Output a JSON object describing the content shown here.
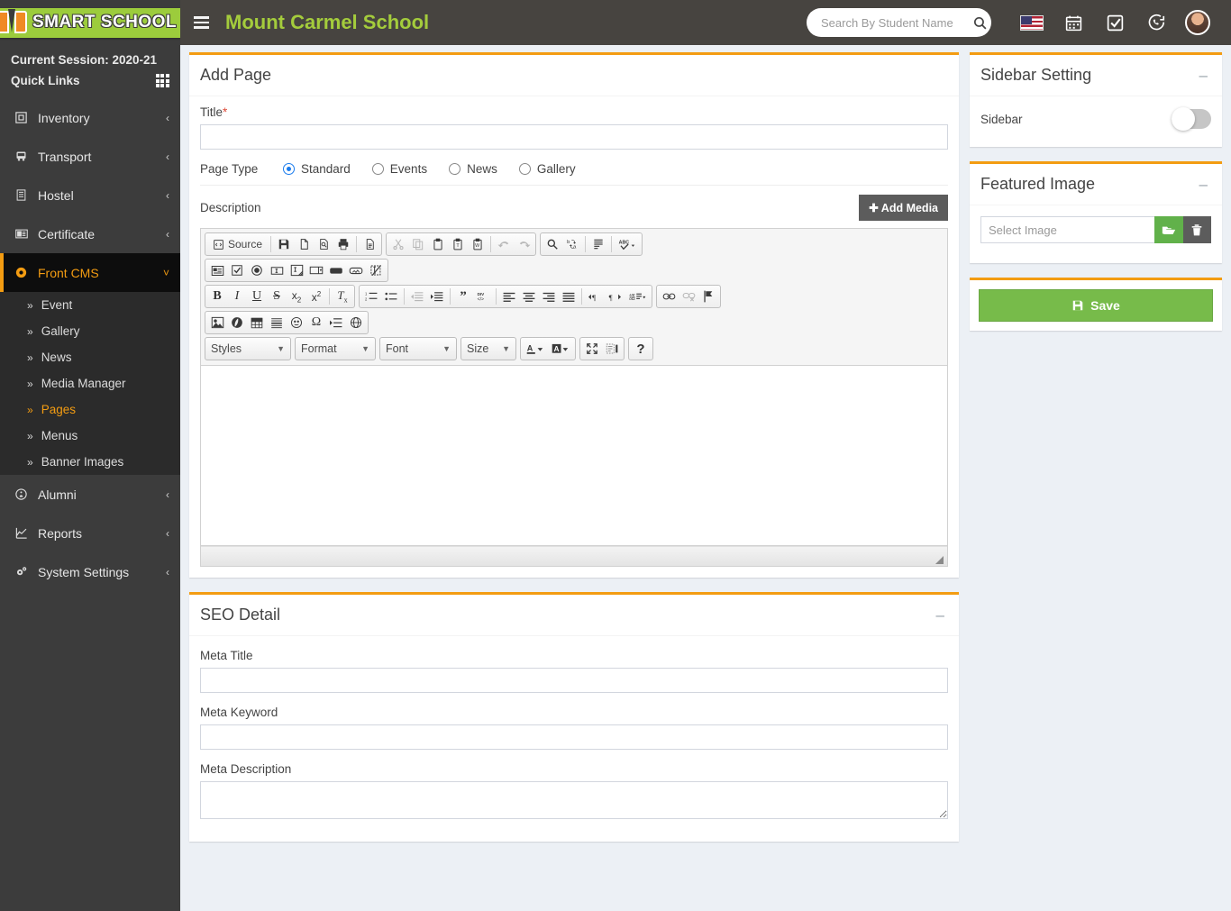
{
  "header": {
    "logo_text": "SMART SCHOOL",
    "school_name": "Mount Carmel School",
    "search_placeholder": "Search By Student Name",
    "icons": [
      "flag-icon",
      "calendar-icon",
      "checkbox-icon",
      "whatsapp-icon",
      "avatar"
    ]
  },
  "sidebar": {
    "session_label": "Current Session: 2020-21",
    "quick_links_label": "Quick Links",
    "items": [
      {
        "label": "Inventory",
        "icon": "inventory-icon",
        "arrow": "‹"
      },
      {
        "label": "Transport",
        "icon": "bus-icon",
        "arrow": "‹"
      },
      {
        "label": "Hostel",
        "icon": "building-icon",
        "arrow": "‹"
      },
      {
        "label": "Certificate",
        "icon": "certificate-icon",
        "arrow": "‹"
      },
      {
        "label": "Front CMS",
        "icon": "cms-icon",
        "arrow": "˅",
        "active": true
      },
      {
        "label": "Alumni",
        "icon": "alumni-icon",
        "arrow": "‹"
      },
      {
        "label": "Reports",
        "icon": "reports-icon",
        "arrow": "‹"
      },
      {
        "label": "System Settings",
        "icon": "gears-icon",
        "arrow": "‹"
      }
    ],
    "submenu": [
      {
        "label": "Event"
      },
      {
        "label": "Gallery"
      },
      {
        "label": "News"
      },
      {
        "label": "Media Manager"
      },
      {
        "label": "Pages",
        "current": true
      },
      {
        "label": "Menus"
      },
      {
        "label": "Banner Images"
      }
    ]
  },
  "add_page": {
    "title": "Add Page",
    "title_label": "Title",
    "title_required": "*",
    "title_value": "",
    "page_type_label": "Page Type",
    "page_types": [
      {
        "label": "Standard",
        "selected": true
      },
      {
        "label": "Events",
        "selected": false
      },
      {
        "label": "News",
        "selected": false
      },
      {
        "label": "Gallery",
        "selected": false
      }
    ],
    "description_label": "Description",
    "add_media_label": "Add Media",
    "add_media_icon": "plus-icon"
  },
  "editor": {
    "source_label": "Source",
    "styles_label": "Styles",
    "format_label": "Format",
    "font_label": "Font",
    "size_label": "Size",
    "content": "",
    "row1_group1": [
      "source-button",
      "save-icon",
      "new-page-icon",
      "preview-icon",
      "print-icon",
      "templates-icon"
    ],
    "row1_group2": [
      "cut-icon",
      "copy-icon",
      "paste-icon",
      "paste-text-icon",
      "paste-word-icon",
      "undo-icon",
      "redo-icon"
    ],
    "row1_group3": [
      "find-icon",
      "replace-icon",
      "select-all-icon",
      "spellcheck-icon"
    ],
    "row2_group1": [
      "form-icon",
      "checkbox-icon",
      "radio-icon",
      "text-field-icon",
      "textarea-icon",
      "select-icon",
      "button-icon",
      "image-button-icon",
      "hidden-field-icon"
    ],
    "row3_group1": [
      "bold-icon",
      "italic-icon",
      "underline-icon",
      "strike-icon",
      "subscript-icon",
      "superscript-icon",
      "remove-format-icon"
    ],
    "row3_group2": [
      "numbered-list-icon",
      "bulleted-list-icon",
      "outdent-icon",
      "indent-icon",
      "blockquote-icon",
      "div-icon",
      "align-left-icon",
      "align-center-icon",
      "align-right-icon",
      "justify-icon",
      "ltr-icon",
      "rtl-icon",
      "language-icon"
    ],
    "row3_group3": [
      "link-icon",
      "unlink-icon",
      "anchor-icon"
    ],
    "row4_group1": [
      "image-icon",
      "flash-icon",
      "table-icon",
      "horizontal-rule-icon",
      "smiley-icon",
      "special-char-icon",
      "page-break-icon",
      "iframe-icon"
    ],
    "row5_group": [
      "text-color-icon",
      "background-color-icon",
      "maximize-icon",
      "show-blocks-icon",
      "about-icon"
    ]
  },
  "seo": {
    "title": "SEO Detail",
    "meta_title_label": "Meta Title",
    "meta_title_value": "",
    "meta_keyword_label": "Meta Keyword",
    "meta_keyword_value": "",
    "meta_description_label": "Meta Description",
    "meta_description_value": ""
  },
  "sidebar_setting": {
    "title": "Sidebar Setting",
    "label": "Sidebar",
    "enabled": false
  },
  "featured_image": {
    "title": "Featured Image",
    "placeholder": "Select Image",
    "value": "",
    "open_icon": "folder-open-icon",
    "delete_icon": "trash-icon"
  },
  "save": {
    "label": "Save",
    "icon": "floppy-icon"
  },
  "colors": {
    "accent": "#f39c12",
    "brand_green": "#a4cc3c",
    "save_green": "#77bb4a",
    "sidebar_bg": "#3c3c3c",
    "navbar_bg": "#474440"
  }
}
